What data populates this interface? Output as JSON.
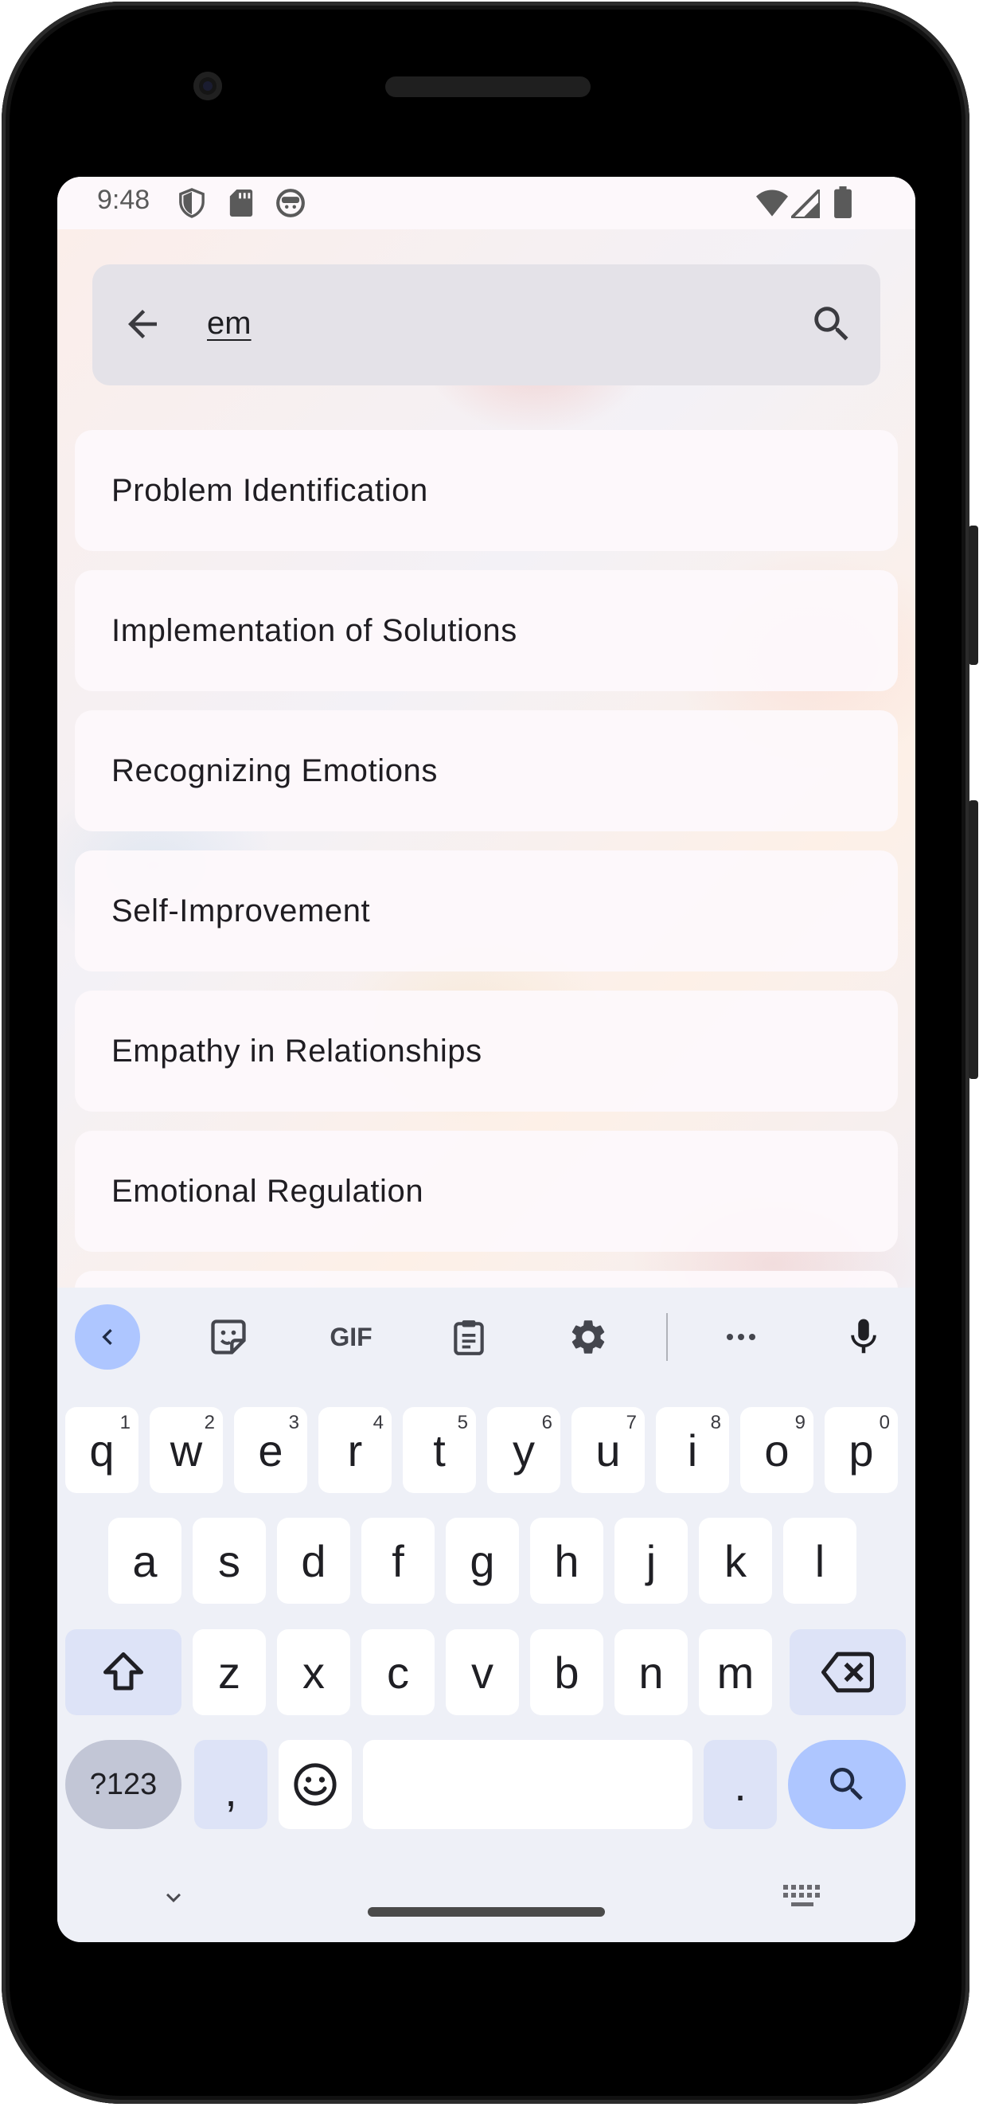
{
  "status_bar": {
    "time": "9:48",
    "icons": [
      "shield-icon",
      "sd-card-icon",
      "face-icon",
      "wifi-icon",
      "signal-icon",
      "battery-icon"
    ]
  },
  "search": {
    "query": "em",
    "back_icon": "arrow-back-icon",
    "search_icon": "search-icon"
  },
  "results": [
    "Problem Identification",
    "Implementation of Solutions",
    "Recognizing Emotions",
    "Self-Improvement",
    "Empathy in Relationships",
    "Emotional Regulation"
  ],
  "keyboard": {
    "toolbar": {
      "collapse": "chevron-left-icon",
      "sticker": "sticker-icon",
      "gif": "GIF",
      "clipboard": "clipboard-icon",
      "settings": "gear-icon",
      "more": "more-horiz-icon",
      "mic": "mic-icon"
    },
    "row1": [
      {
        "ch": "q",
        "num": "1"
      },
      {
        "ch": "w",
        "num": "2"
      },
      {
        "ch": "e",
        "num": "3"
      },
      {
        "ch": "r",
        "num": "4"
      },
      {
        "ch": "t",
        "num": "5"
      },
      {
        "ch": "y",
        "num": "6"
      },
      {
        "ch": "u",
        "num": "7"
      },
      {
        "ch": "i",
        "num": "8"
      },
      {
        "ch": "o",
        "num": "9"
      },
      {
        "ch": "p",
        "num": "0"
      }
    ],
    "row2": [
      "a",
      "s",
      "d",
      "f",
      "g",
      "h",
      "j",
      "k",
      "l"
    ],
    "row3": [
      "z",
      "x",
      "c",
      "v",
      "b",
      "n",
      "m"
    ],
    "mode_key": "?123",
    "comma": ",",
    "period": ".",
    "emoji_icon": "emoji-icon",
    "space": "",
    "enter_icon": "search-icon"
  },
  "colors": {
    "accent": "#aec6ff",
    "key_special": "#dde3f7",
    "keyboard_bg": "#eef0f7",
    "search_bar_bg": "#e4e2e8"
  }
}
